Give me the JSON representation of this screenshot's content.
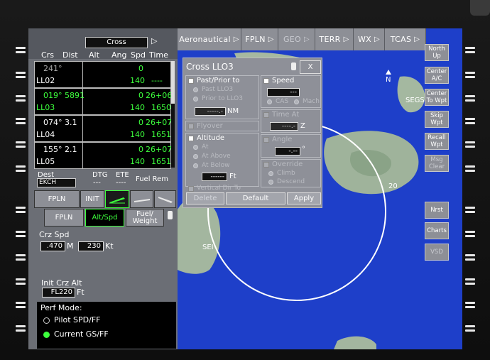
{
  "top_tabs": [
    {
      "label": "Aeronautical",
      "arrow": "▷"
    },
    {
      "label": "FPLN",
      "arrow": "▷"
    },
    {
      "label": "GEO",
      "arrow": "▷"
    },
    {
      "label": "TERR",
      "arrow": "▷"
    },
    {
      "label": "WX",
      "arrow": "▷"
    },
    {
      "label": "TCAS",
      "arrow": "▷"
    }
  ],
  "right_buttons": {
    "north_up": [
      "North",
      "Up"
    ],
    "center_ac": [
      "Center",
      "A/C"
    ],
    "center_wpt": [
      "Center",
      "To Wpt"
    ],
    "skip_wpt": [
      "Skip",
      "Wpt"
    ],
    "recall_wpt": [
      "Recall",
      "Wpt"
    ],
    "msg_clear": [
      "Msg",
      "Clear"
    ],
    "nrst": "Nrst",
    "charts": "Charts",
    "vsd": "VSD"
  },
  "map": {
    "waypoint_segs": "SEGS",
    "waypoint_sei": "SEI",
    "range_ring_label": "20",
    "north_marker": "N"
  },
  "fms": {
    "title": "Cross",
    "title_arrow": "▷",
    "columns": {
      "crs": "Crs",
      "dist": "Dist",
      "alt": "Alt",
      "ang": "Ang",
      "spd": "Spd",
      "time": "Time"
    },
    "legs": [
      {
        "crs": "241°",
        "dist": "",
        "wpt": "LL02",
        "ang": "0",
        "alt": "",
        "spd": "140",
        "time": "----",
        "active": false
      },
      {
        "crs": "019°",
        "dist": "5891",
        "wpt": "LL03",
        "ang": "0",
        "alt": "26+06",
        "spd": "140",
        "time": "1650",
        "active": true
      },
      {
        "crs": "074°",
        "dist": "3.1",
        "wpt": "LL04",
        "ang": "0",
        "alt": "26+07",
        "spd": "140",
        "time": "1651",
        "active": false
      },
      {
        "crs": "155°",
        "dist": "2.1",
        "wpt": "LL05",
        "ang": "0",
        "alt": "26+07",
        "spd": "140",
        "time": "1651",
        "active": false
      }
    ],
    "dest_label": "Dest",
    "dest_value": "EKCH",
    "dtg_label": "DTG",
    "dtg_value": "---",
    "ete_label": "ETE",
    "ete_value": "----",
    "fuel_rem_label": "Fuel Rem",
    "tabs_row1": [
      "FPLN",
      "INIT"
    ],
    "tabs_row2": [
      "FPLN",
      "Alt/Spd",
      "Fuel/\nWeight"
    ],
    "crz_spd_label": "Crz Spd",
    "crz_spd_mach": ".470",
    "crz_spd_mach_unit": "M",
    "crz_spd_kt": "230",
    "crz_spd_kt_unit": "Kt",
    "init_crz_alt_label": "Init Crz Alt",
    "init_crz_alt_value": "FL220",
    "init_crz_alt_unit": "Ft",
    "perf_mode_label": "Perf Mode:",
    "perf_options": [
      {
        "label": "Pilot SPD/FF",
        "selected": false
      },
      {
        "label": "Current GS/FF",
        "selected": true
      }
    ]
  },
  "dialog": {
    "title": "Cross LLO3",
    "close_label": "X",
    "past_prior_to_label": "Past/Prior to",
    "past_option": "Past LLO3",
    "prior_option": "Prior to LLO3",
    "distance_value": "-----.-",
    "distance_unit": "NM",
    "flyover_label": "Flyover",
    "altitude_label": "Altitude",
    "alt_at": "At",
    "alt_at_above": "At Above",
    "alt_at_below": "At Below",
    "alt_value": "------",
    "alt_unit": "Ft",
    "vertical_dir_to_label": "Vertical Dir To",
    "speed_label": "Speed",
    "speed_value": "---",
    "speed_cas": "CAS",
    "speed_mach": "Mach",
    "time_at_label": "Time At",
    "time_value": "----.-",
    "time_unit": "Z",
    "angle_label": "Angle",
    "angle_value": "-.--",
    "angle_unit": "°",
    "override_label": "Override",
    "climb_label": "Climb",
    "descend_label": "Descend",
    "delete_label": "Delete",
    "default_label": "Default",
    "apply_label": "Apply"
  }
}
